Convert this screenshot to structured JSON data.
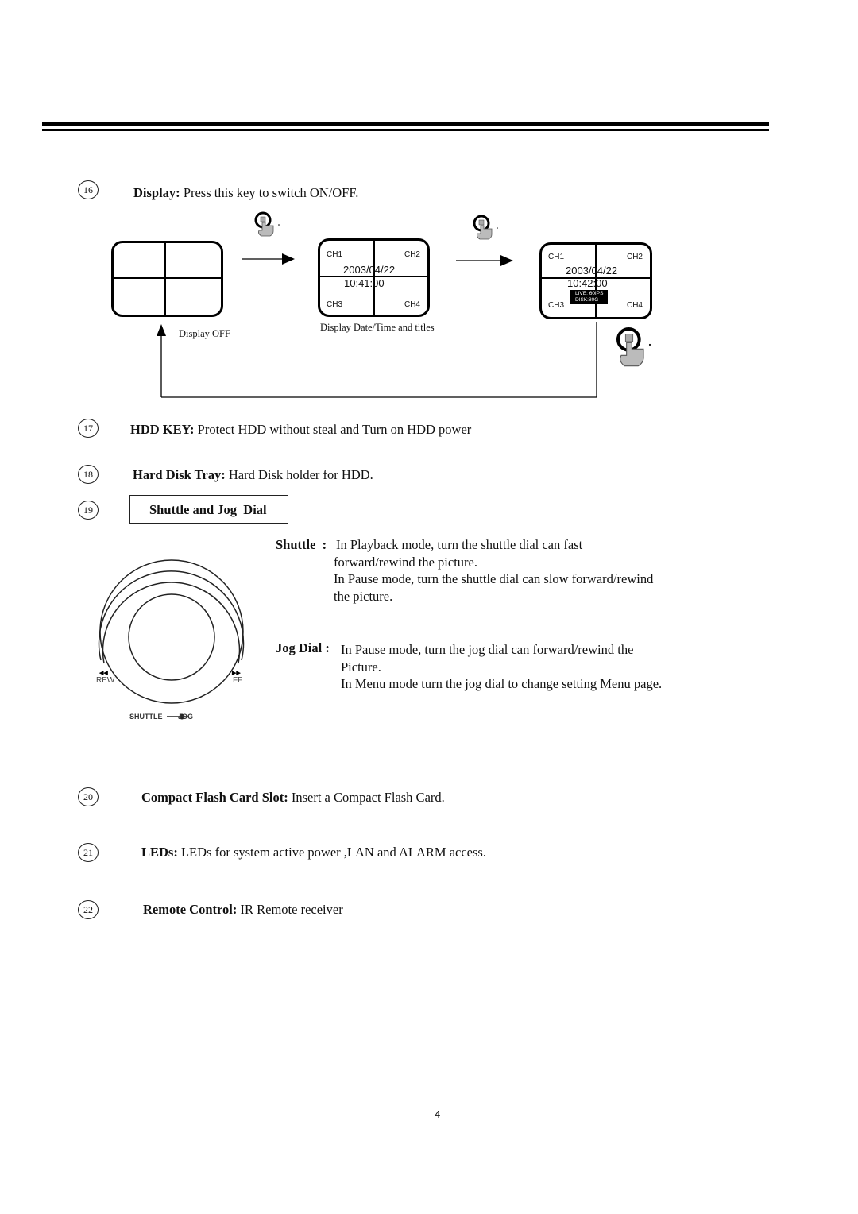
{
  "items": [
    {
      "number": "16",
      "label": "Display:",
      "text": " Press this key to switch ON/OFF."
    },
    {
      "number": "17",
      "label": "HDD KEY:",
      "text": " Protect HDD without steal and Turn on HDD power"
    },
    {
      "number": "18",
      "label": "Hard Disk Tray:",
      "text": " Hard Disk holder for HDD."
    },
    {
      "number": "19",
      "label": "Shuttle and Jog  Dial",
      "text": ""
    },
    {
      "number": "20",
      "label": "Compact Flash Card Slot:",
      "text": " Insert a Compact Flash Card."
    },
    {
      "number": "21",
      "label": "LEDs:",
      "text": " LEDs for system active power ,LAN and ALARM access."
    },
    {
      "number": "22",
      "label": "Remote Control:",
      "text": " IR Remote receiver"
    }
  ],
  "display_diagram": {
    "off_caption": "Display OFF",
    "on_caption": "Display Date/Time and titles",
    "channels": [
      "CH1",
      "CH2",
      "CH3",
      "CH4"
    ],
    "screen2": {
      "date": "2003/04/22",
      "time": "10:41:00"
    },
    "screen3": {
      "date": "2003/04/22",
      "time": "10:42:00",
      "osd_line1": "LIVE: 60IPS",
      "osd_line2": "DISK:80G"
    }
  },
  "shuttle": {
    "label": "Shuttle  :",
    "lines": [
      "In Playback mode, turn the shuttle dial can fast",
      "forward/rewind the picture.",
      "In Pause mode, turn the shuttle dial can slow forward/rewind",
      "the picture."
    ]
  },
  "jog": {
    "label": "Jog Dial :",
    "lines": [
      "In Pause mode, turn the jog dial can forward/rewind the",
      "Picture.",
      "In Menu mode turn the jog dial to change setting Menu page."
    ]
  },
  "dial_figure": {
    "rew_label": "REW",
    "ff_label": "FF",
    "shuttle_label": "SHUTTLE",
    "jog_label": "JOG"
  },
  "page_number": "4"
}
